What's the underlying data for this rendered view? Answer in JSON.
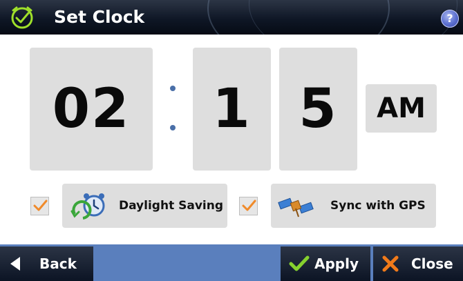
{
  "header": {
    "title": "Set Clock",
    "icon": "clock-icon",
    "help_label": "?"
  },
  "time": {
    "hour": "02",
    "minute_tens": "1",
    "minute_ones": "5",
    "period": "AM"
  },
  "options": {
    "daylight_saving": {
      "label": "Daylight Saving",
      "checked": true,
      "icon": "alarm-clock-icon"
    },
    "sync_gps": {
      "label": "Sync with GPS",
      "checked": true,
      "icon": "satellite-icon"
    }
  },
  "footer": {
    "back_label": "Back",
    "apply_label": "Apply",
    "close_label": "Close"
  },
  "colors": {
    "title_bar": "#0f1726",
    "bottom_bar": "#5a7fbd",
    "panel": "#dedede",
    "check": "#f08a2a",
    "accent_green": "#86d12e"
  }
}
